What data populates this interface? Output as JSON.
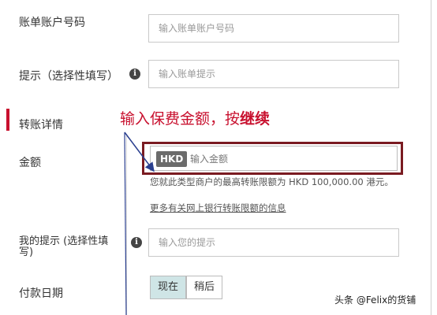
{
  "form": {
    "account_number": {
      "label": "账单账户号码",
      "placeholder": "输入账单账户号码"
    },
    "reminder": {
      "label": "提示（选择性填写）",
      "placeholder": "输入账单提示"
    },
    "section_title": "转账详情",
    "amount": {
      "label": "金额",
      "currency": "HKD",
      "placeholder": "输入金额"
    },
    "limit_note": "您就此类型商户的最高转账限额为 HKD 100,000.00 港元。",
    "limit_link": "更多有关网上银行转账限额的信息",
    "my_reminder": {
      "label": "我的提示 (选择性填写)",
      "placeholder": "输入您的提示"
    },
    "payment_date": {
      "label": "付款日期",
      "option_now": "现在",
      "option_later": "稍后",
      "selected": "现在"
    }
  },
  "annotation": {
    "text": "输入保费金额，按",
    "bold": "继续",
    "color": "#c8102e"
  },
  "watermark": "头条 @Felix的货铺",
  "colors": {
    "accent_red": "#c8102e",
    "highlight_border": "#7a1b21",
    "selected_button": "#cfe5e6"
  }
}
